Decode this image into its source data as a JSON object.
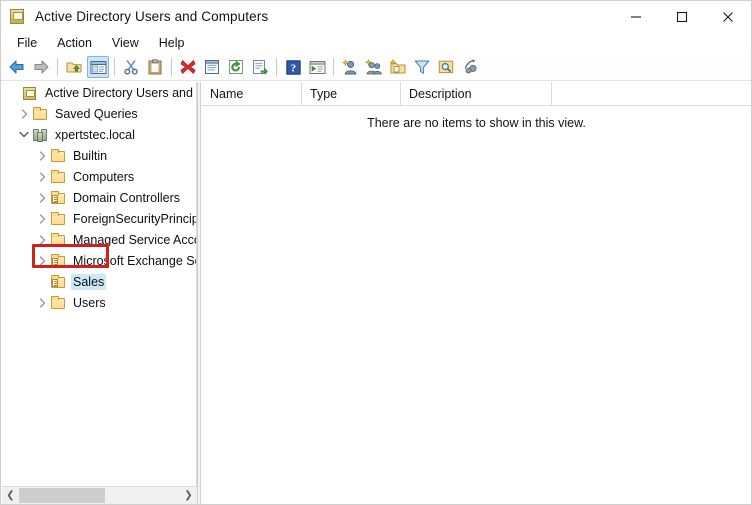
{
  "window": {
    "title": "Active Directory Users and Computers",
    "title_icon": "console-icon",
    "minimize_label": "minimize-icon",
    "maximize_label": "maximize-icon",
    "close_label": "close-icon"
  },
  "menu": {
    "items": [
      {
        "label": "File"
      },
      {
        "label": "Action"
      },
      {
        "label": "View"
      },
      {
        "label": "Help"
      }
    ]
  },
  "toolbar": {
    "buttons": [
      {
        "name": "back-icon",
        "title": "Back"
      },
      {
        "name": "forward-icon",
        "title": "Forward"
      },
      {
        "sep": true
      },
      {
        "name": "up-one-level-icon",
        "title": "Up One Level"
      },
      {
        "name": "show-hide-console-tree-icon",
        "title": "Show/Hide Console Tree",
        "active": true
      },
      {
        "sep": true
      },
      {
        "name": "cut-icon",
        "title": "Cut"
      },
      {
        "name": "paste-icon",
        "title": "Paste"
      },
      {
        "sep": true
      },
      {
        "name": "delete-icon",
        "title": "Delete"
      },
      {
        "name": "properties-icon",
        "title": "Properties"
      },
      {
        "name": "refresh-icon",
        "title": "Refresh"
      },
      {
        "name": "export-list-icon",
        "title": "Export List"
      },
      {
        "sep": true
      },
      {
        "name": "help-icon",
        "title": "Help"
      },
      {
        "name": "show-hide-action-pane-icon",
        "title": "Show/Hide Action Pane"
      },
      {
        "sep": true
      },
      {
        "name": "new-user-icon",
        "title": "New User"
      },
      {
        "name": "new-group-icon",
        "title": "New Group"
      },
      {
        "name": "new-organizational-unit-icon",
        "title": "New Organizational Unit"
      },
      {
        "name": "filter-icon",
        "title": "Filter"
      },
      {
        "name": "find-icon",
        "title": "Find"
      },
      {
        "name": "saved-query-icon",
        "title": "Saved Query"
      }
    ]
  },
  "tree": {
    "nodes": [
      {
        "label": "Active Directory Users and Com",
        "icon": "console-icon",
        "indent": 0,
        "toggle": "none",
        "selected": false
      },
      {
        "label": "Saved Queries",
        "icon": "folder-icon",
        "indent": 1,
        "toggle": "collapsed",
        "selected": false
      },
      {
        "label": "xpertstec.local",
        "icon": "domain-icon",
        "indent": 1,
        "toggle": "expanded",
        "selected": false
      },
      {
        "label": "Builtin",
        "icon": "folder-icon",
        "indent": 2,
        "toggle": "collapsed",
        "selected": false
      },
      {
        "label": "Computers",
        "icon": "folder-icon",
        "indent": 2,
        "toggle": "collapsed",
        "selected": false
      },
      {
        "label": "Domain Controllers",
        "icon": "ou-folder-icon",
        "indent": 2,
        "toggle": "collapsed",
        "selected": false
      },
      {
        "label": "ForeignSecurityPrincipals",
        "icon": "folder-icon",
        "indent": 2,
        "toggle": "collapsed",
        "selected": false
      },
      {
        "label": "Managed Service Accounts",
        "icon": "folder-icon",
        "indent": 2,
        "toggle": "collapsed",
        "selected": false
      },
      {
        "label": "Microsoft Exchange Security Groups",
        "icon": "ou-folder-icon",
        "indent": 2,
        "toggle": "collapsed",
        "selected": false
      },
      {
        "label": "Sales",
        "icon": "ou-folder-icon",
        "indent": 2,
        "toggle": "none",
        "selected": true
      },
      {
        "label": "Users",
        "icon": "folder-icon",
        "indent": 2,
        "toggle": "collapsed",
        "selected": false
      }
    ],
    "highlight": {
      "target": "Sales",
      "color": "#cc2222"
    },
    "scrollbar": {
      "left_arrow": "❮",
      "right_arrow": "❯"
    }
  },
  "list": {
    "columns": [
      {
        "label": "Name",
        "width": 100
      },
      {
        "label": "Type",
        "width": 99
      },
      {
        "label": "Description",
        "width": 151
      }
    ],
    "empty_message": "There are no items to show in this view."
  },
  "colors": {
    "selection": "#cde8f6",
    "highlight": "#cc2222",
    "toolbar_active": "#cde6f7"
  }
}
